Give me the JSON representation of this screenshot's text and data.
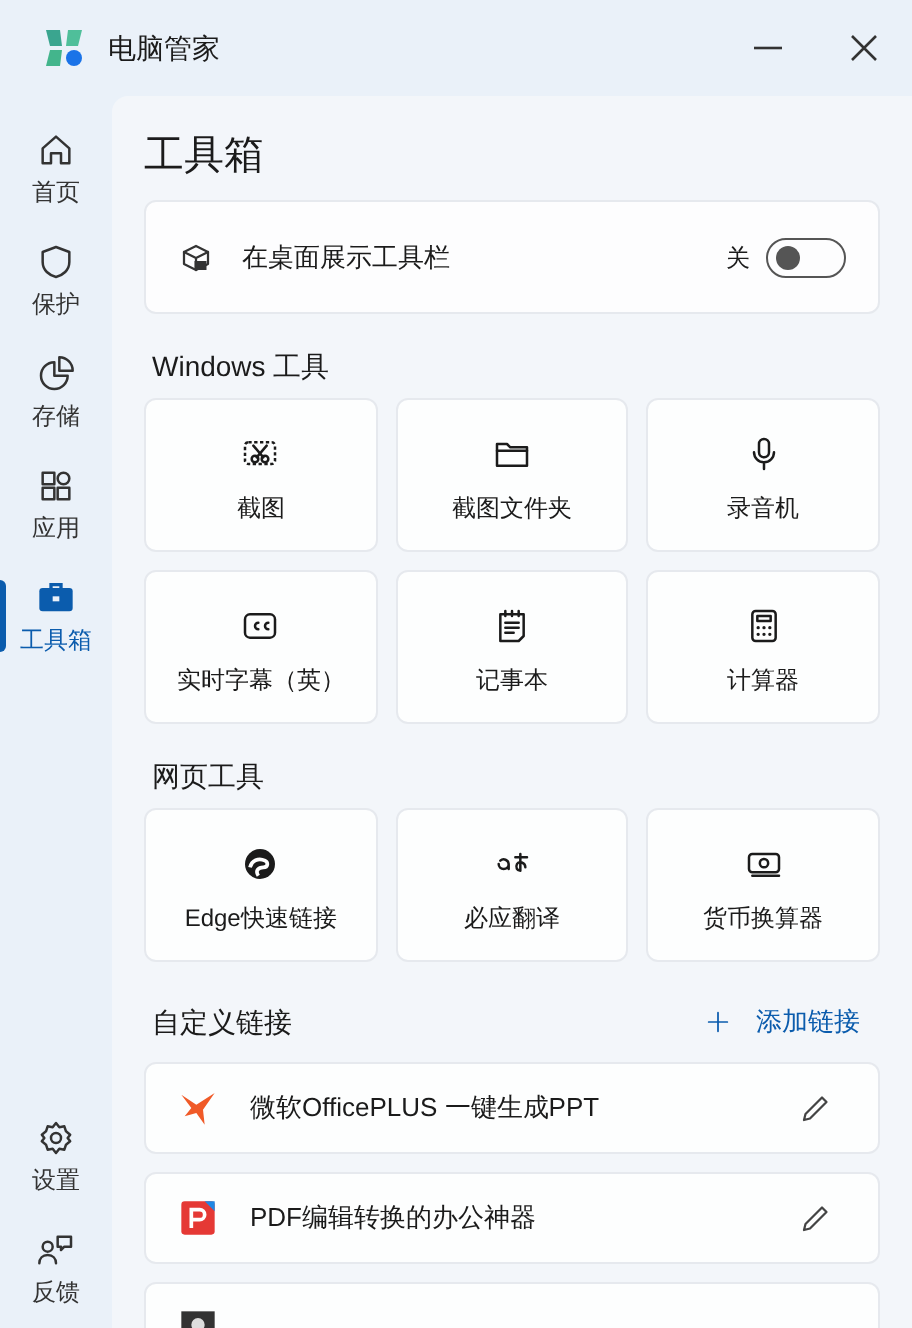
{
  "window": {
    "title": "电脑管家"
  },
  "sidebar": {
    "items": [
      {
        "label": "首页",
        "selected": false
      },
      {
        "label": "保护",
        "selected": false
      },
      {
        "label": "存储",
        "selected": false
      },
      {
        "label": "应用",
        "selected": false
      },
      {
        "label": "工具箱",
        "selected": true
      }
    ],
    "bottom_items": [
      {
        "label": "设置"
      },
      {
        "label": "反馈"
      }
    ]
  },
  "page_title": "工具箱",
  "desktop_toolbar": {
    "label": "在桌面展示工具栏",
    "state_label": "关",
    "on": false
  },
  "sections": [
    {
      "title": "Windows 工具",
      "tools": [
        {
          "label": "截图"
        },
        {
          "label": "截图文件夹"
        },
        {
          "label": "录音机"
        },
        {
          "label": "实时字幕（英）"
        },
        {
          "label": "记事本"
        },
        {
          "label": "计算器"
        }
      ]
    },
    {
      "title": "网页工具",
      "tools": [
        {
          "label": "Edge快速链接"
        },
        {
          "label": "必应翻译"
        },
        {
          "label": "货币换算器"
        }
      ]
    }
  ],
  "custom_links": {
    "title": "自定义链接",
    "add_label": "添加链接",
    "items": [
      {
        "kind": "bird",
        "title": "微软OfficePLUS 一键生成PPT"
      },
      {
        "kind": "pdf",
        "title": "PDF编辑转换的办公神器"
      },
      {
        "kind": "avatar"
      }
    ]
  }
}
